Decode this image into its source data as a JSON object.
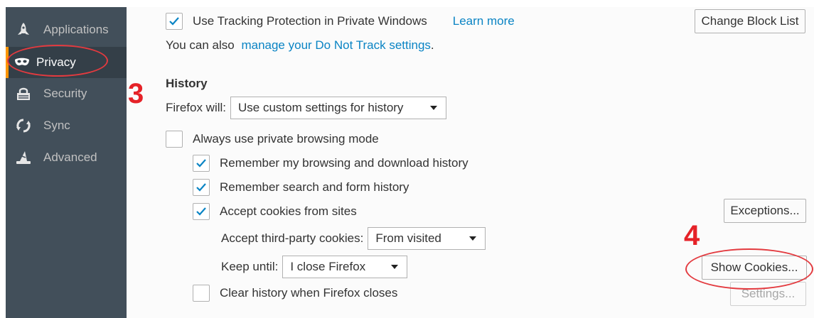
{
  "sidebar": {
    "items": [
      {
        "label": "Applications",
        "icon": "rocket-icon"
      },
      {
        "label": "Privacy",
        "icon": "mask-icon",
        "selected": true
      },
      {
        "label": "Security",
        "icon": "lock-icon"
      },
      {
        "label": "Sync",
        "icon": "sync-icon"
      },
      {
        "label": "Advanced",
        "icon": "wizard-hat-icon"
      }
    ]
  },
  "tracking": {
    "checkbox_label": "Use Tracking Protection in Private Windows",
    "checked": true,
    "learn_more": "Learn more",
    "change_block_list": "Change Block List",
    "dnt_prefix": "You can also ",
    "dnt_link": "manage your Do Not Track settings",
    "dnt_suffix": "."
  },
  "history": {
    "heading": "History",
    "firefox_will_label": "Firefox will:",
    "firefox_will_value": "Use custom settings for history",
    "always_private": {
      "label": "Always use private browsing mode",
      "checked": false
    },
    "remember_browsing": {
      "label": "Remember my browsing and download history",
      "checked": true
    },
    "remember_search": {
      "label": "Remember search and form history",
      "checked": true
    },
    "accept_cookies": {
      "label": "Accept cookies from sites",
      "checked": true
    },
    "exceptions_button": "Exceptions...",
    "third_party_label": "Accept third-party cookies:",
    "third_party_value": "From visited",
    "keep_until_label": "Keep until:",
    "keep_until_value": "I close Firefox",
    "show_cookies_button": "Show Cookies...",
    "clear_history": {
      "label": "Clear history when Firefox closes",
      "checked": false
    },
    "settings_button": "Settings..."
  },
  "annotations": {
    "step3": "3",
    "step4": "4"
  },
  "colors": {
    "sidebar_bg": "#424f5a",
    "sidebar_selected": "#343f48",
    "accent_orange": "#ff9500",
    "link_blue": "#0a84c4",
    "annotation_red": "#e52228"
  }
}
